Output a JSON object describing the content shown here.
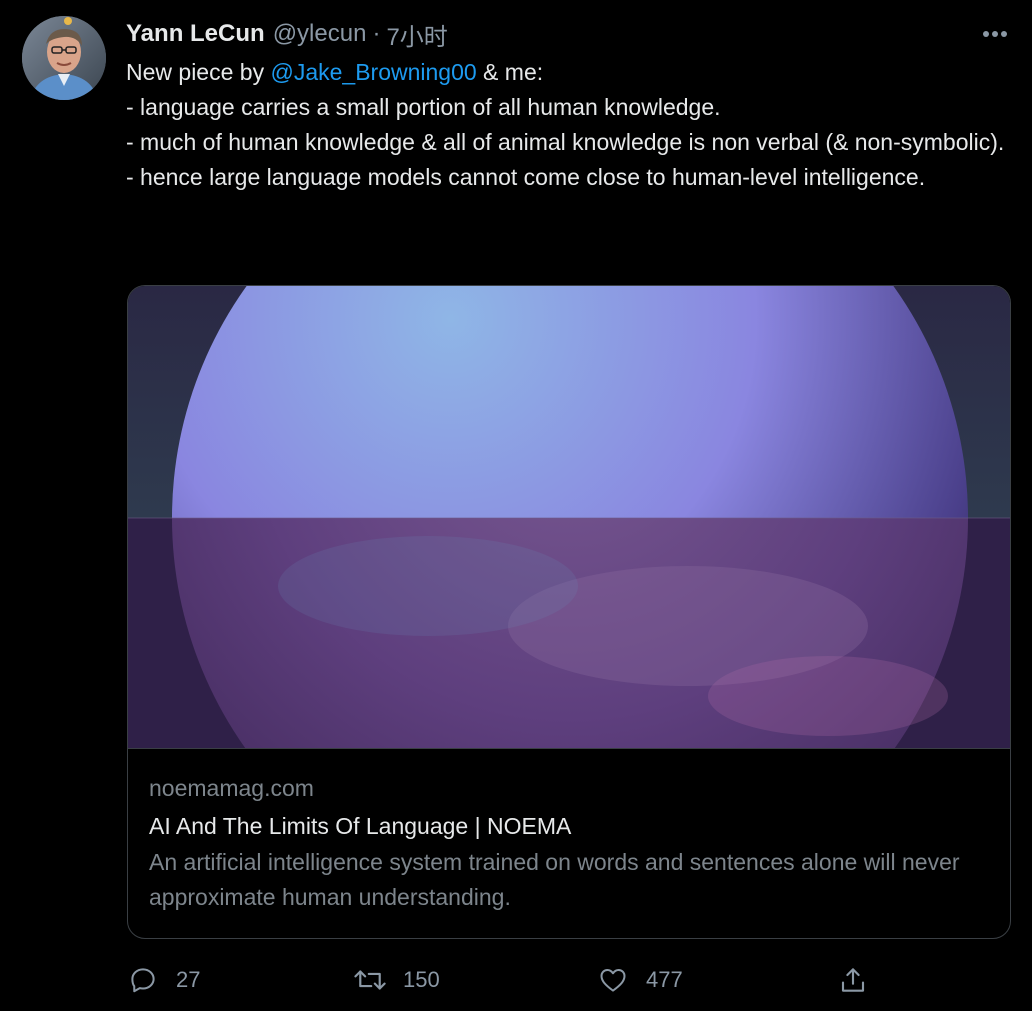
{
  "tweet": {
    "author": {
      "name": "Yann LeCun",
      "handle": "@ylecun",
      "separator": "·",
      "time": "7小时"
    },
    "text": {
      "line1_prefix": "New piece by ",
      "mention": "@Jake_Browning00",
      "line1_suffix": " & me:",
      "line2": "- language carries a small portion of all human knowledge.",
      "line3": "- much of human knowledge & all of animal knowledge is non verbal (& non-symbolic).",
      "line4": "- hence large language models cannot come close to human-level intelligence."
    },
    "card": {
      "domain": "noemamag.com",
      "title": "AI And The Limits Of Language | NOEMA",
      "description": "An artificial intelligence system trained on words and sentences alone will never approximate human understanding."
    },
    "actions": {
      "reply_count": "27",
      "retweet_count": "150",
      "like_count": "477"
    }
  },
  "icons": {
    "more": "more-horizontal-icon",
    "reply": "reply-icon",
    "retweet": "retweet-icon",
    "like": "heart-icon",
    "share": "share-icon"
  },
  "colors": {
    "background": "#000000",
    "text": "#e7e9ea",
    "secondary_text": "#8b98a5",
    "link": "#1d9bf0",
    "border": "#3a3f44"
  }
}
